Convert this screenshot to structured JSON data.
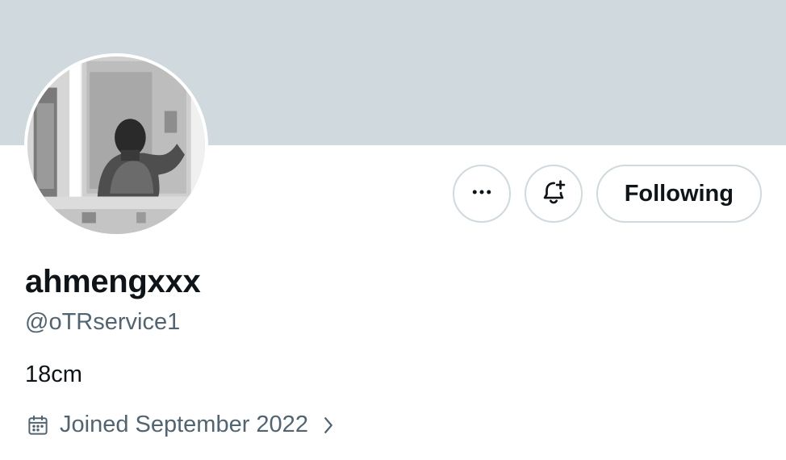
{
  "profile": {
    "display_name": "ahmengxxx",
    "handle": "@oTRservice1",
    "bio": "18cm",
    "joined": "Joined September 2022"
  },
  "actions": {
    "more_icon": "more-horizontal-icon",
    "notify_icon": "bell-plus-icon",
    "follow_label": "Following"
  },
  "colors": {
    "banner": "#cfd9de",
    "border": "#cfd9de",
    "primary_text": "#0f1419",
    "secondary_text": "#536471"
  }
}
